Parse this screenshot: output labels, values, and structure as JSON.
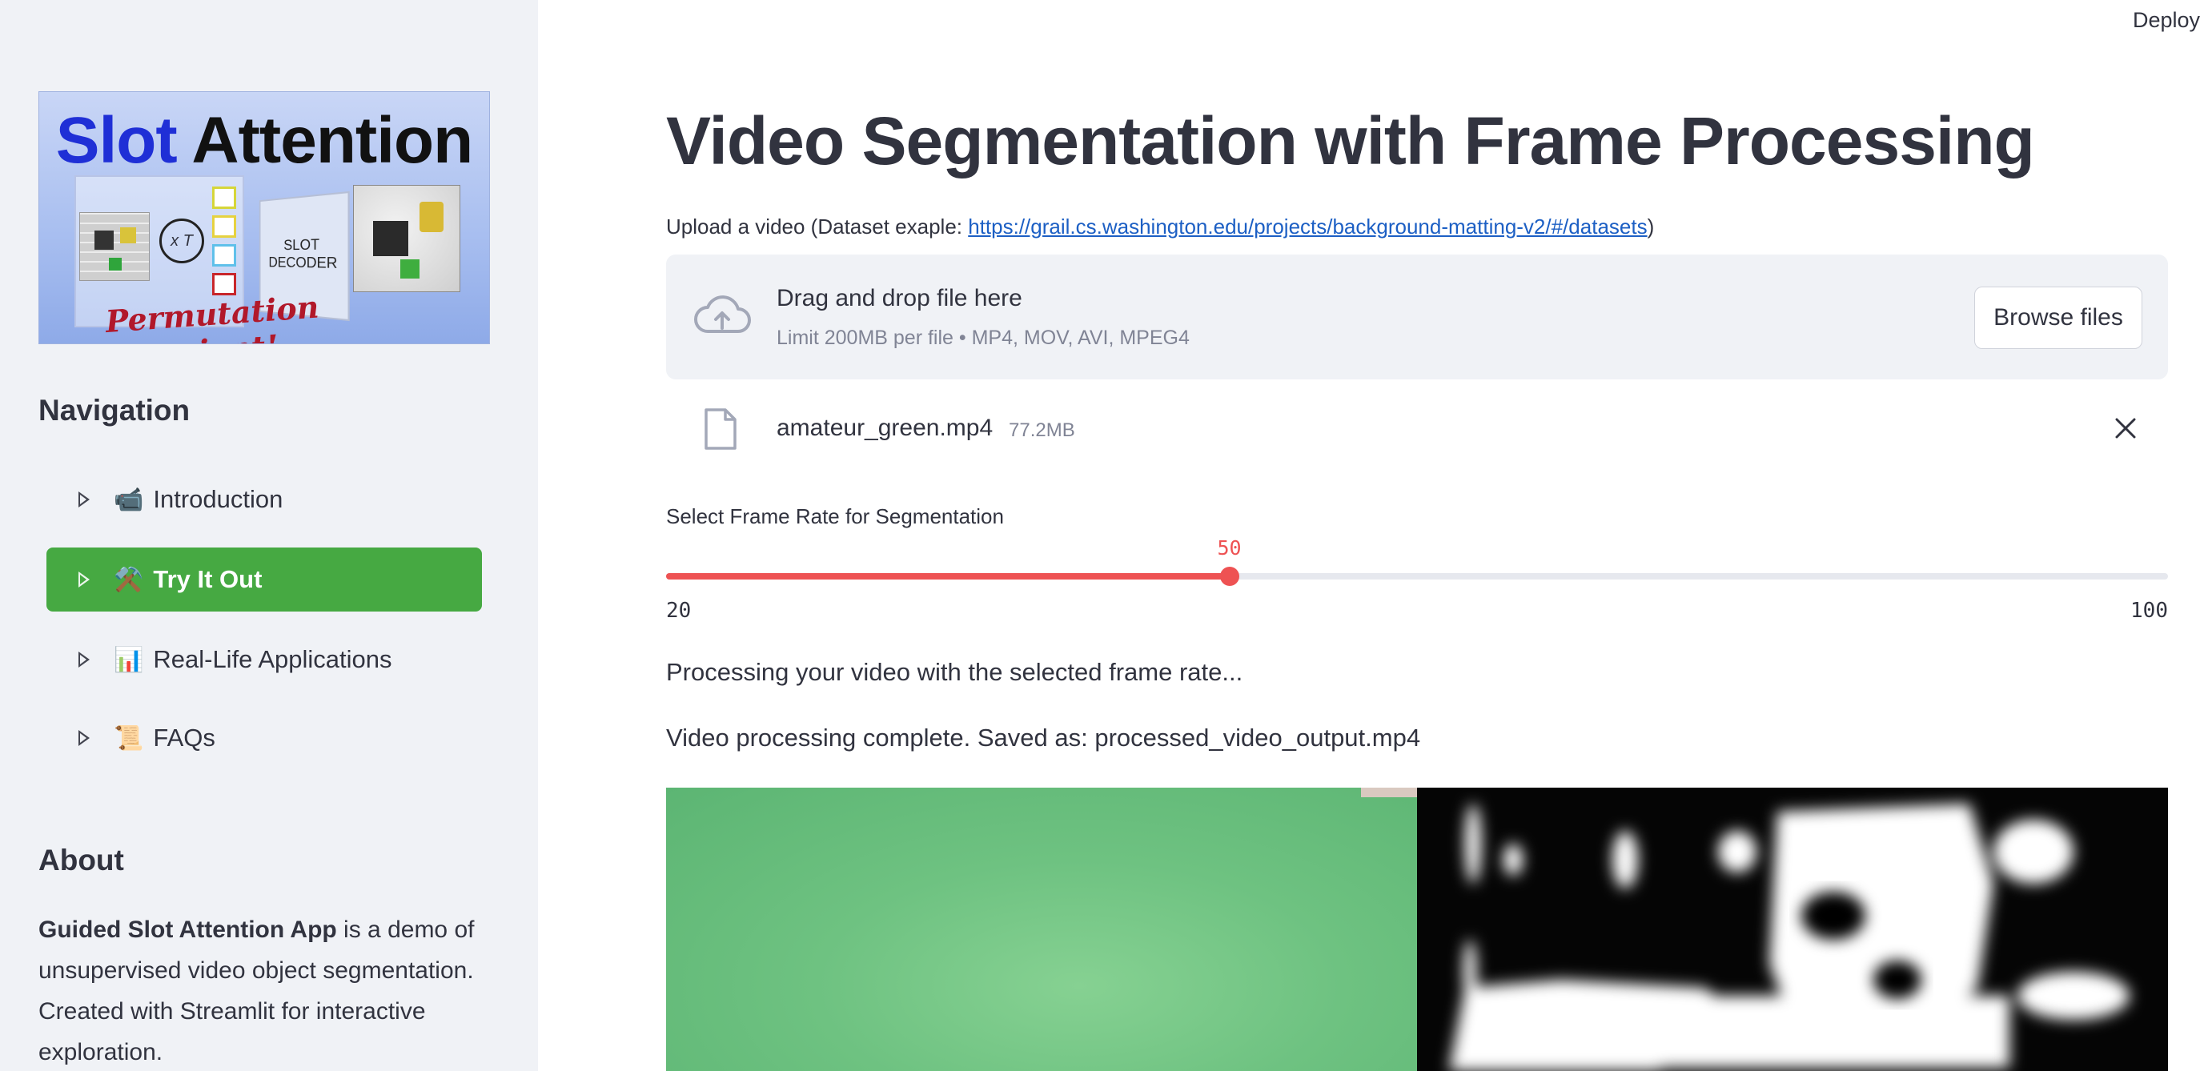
{
  "header": {
    "deploy_label": "Deploy"
  },
  "sidebar": {
    "logo": {
      "title_part1": "Slot",
      "title_part2": "Attention",
      "iter_label": "x T",
      "decoder_label": "SLOT DECODER",
      "tagline": "Permutation Invariant!"
    },
    "nav_heading": "Navigation",
    "nav_items": [
      {
        "emoji": "📹",
        "label": "Introduction",
        "active": false
      },
      {
        "emoji": "⚒️",
        "label": "Try It Out",
        "active": true
      },
      {
        "emoji": "📊",
        "label": "Real-Life Applications",
        "active": false
      },
      {
        "emoji": "📜",
        "label": "FAQs",
        "active": false
      }
    ],
    "about_heading": "About",
    "about_bold": "Guided Slot Attention App",
    "about_rest": " is a demo of unsupervised video object segmentation. Created with Streamlit for interactive exploration."
  },
  "main": {
    "title": "Video Segmentation with Frame Processing",
    "upload_label_prefix": "Upload a video (Dataset exaple: ",
    "upload_link": "https://grail.cs.washington.edu/projects/background-matting-v2/#/datasets",
    "upload_label_suffix": ")",
    "dropzone": {
      "title": "Drag and drop file here",
      "limit": "Limit 200MB per file • MP4, MOV, AVI, MPEG4",
      "browse_label": "Browse files"
    },
    "file": {
      "name": "amateur_green.mp4",
      "size": "77.2MB"
    },
    "slider": {
      "label": "Select Frame Rate for Segmentation",
      "min": 20,
      "max": 100,
      "value": 50
    },
    "status_processing": "Processing your video with the selected frame rate...",
    "status_complete": "Video processing complete. Saved as: processed_video_output.mp4"
  },
  "colors": {
    "sidebar_bg": "#f0f2f6",
    "active_nav": "#46a942",
    "slider_accent": "#ee5253",
    "link": "#1c5fc4",
    "text": "#31333f"
  }
}
